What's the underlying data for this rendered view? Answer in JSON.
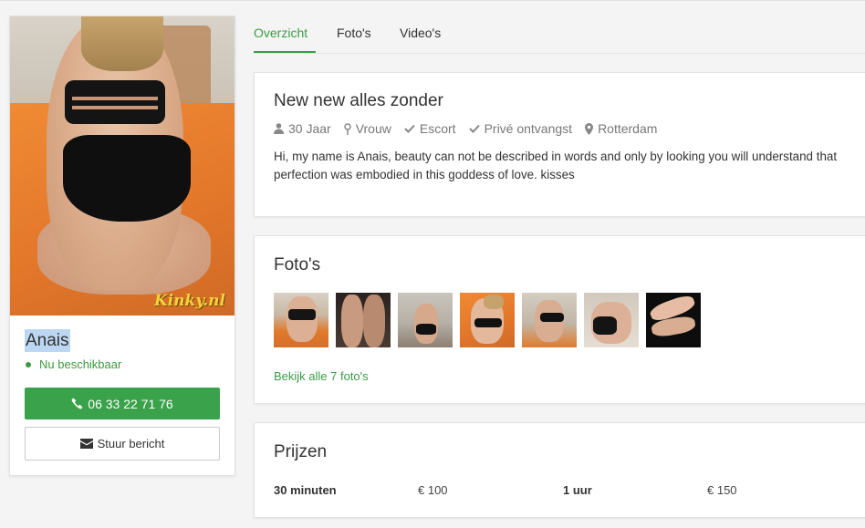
{
  "profile": {
    "name": "Anais",
    "status": "Nu beschikbaar",
    "photo_watermark": "Kinky.nl",
    "phone_button": "06 33 22 71 76",
    "message_button": "Stuur bericht"
  },
  "tabs": [
    {
      "label": "Overzicht",
      "active": true
    },
    {
      "label": "Foto's",
      "active": false
    },
    {
      "label": "Video's",
      "active": false
    }
  ],
  "intro": {
    "title": "New new alles zonder",
    "meta": [
      {
        "icon": "user-icon",
        "text": "30 Jaar"
      },
      {
        "icon": "gender-icon",
        "text": "Vrouw"
      },
      {
        "icon": "check-icon",
        "text": "Escort"
      },
      {
        "icon": "check-icon",
        "text": "Privé ontvangst"
      },
      {
        "icon": "map-marker-icon",
        "text": "Rotterdam"
      }
    ],
    "description": "Hi, my name is Anais, beauty can not be described in words and only by looking you will understand that perfection was embodied in this goddess of love. kisses"
  },
  "photos": {
    "title": "Foto's",
    "count": 7,
    "see_all": "Bekijk alle 7 foto's"
  },
  "prices": {
    "title": "Prijzen",
    "rows": [
      {
        "label": "30 minuten",
        "value": "€ 100"
      },
      {
        "label": "1 uur",
        "value": "€ 150"
      }
    ]
  },
  "colors": {
    "accent": "#3aa24a",
    "link": "#3a9c45",
    "name_highlight": "#bcd7f3"
  }
}
